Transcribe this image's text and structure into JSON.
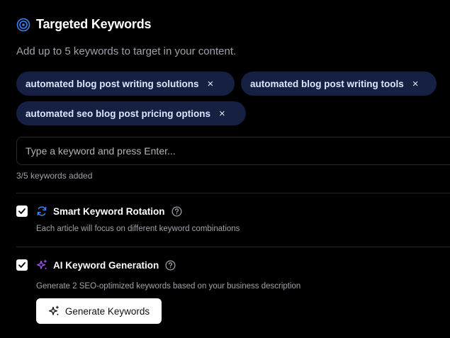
{
  "header": {
    "title": "Targeted Keywords",
    "subtitle": "Add up to 5 keywords to target in your content.",
    "icon": "target-icon"
  },
  "keywords": [
    {
      "label": "automated blog post writing solutions",
      "remove": "×"
    },
    {
      "label": "automated blog post writing tools",
      "remove": "×"
    },
    {
      "label": "automated seo blog post pricing options",
      "remove": "×"
    }
  ],
  "input": {
    "placeholder": "Type a keyword and press Enter...",
    "value": ""
  },
  "count_text": "3/5 keywords added",
  "options": [
    {
      "label": "Smart Keyword Rotation",
      "description": "Each article will focus on different keyword combinations",
      "checked": true,
      "icon": "refresh-icon",
      "icon_color": "#3b82f6"
    },
    {
      "label": "AI Keyword Generation",
      "description": "Generate 2 SEO-optimized keywords based on your business description",
      "checked": true,
      "icon": "sparkles-icon",
      "icon_color": "#a855f7"
    }
  ],
  "generate_button": {
    "label": "Generate Keywords",
    "icon": "sparkles-icon"
  },
  "colors": {
    "background": "#000000",
    "chip_background": "#152043",
    "chip_text": "#dbe6ff",
    "accent_blue": "#3b82f6",
    "accent_purple": "#a855f7",
    "muted_text": "#a1a1aa"
  }
}
